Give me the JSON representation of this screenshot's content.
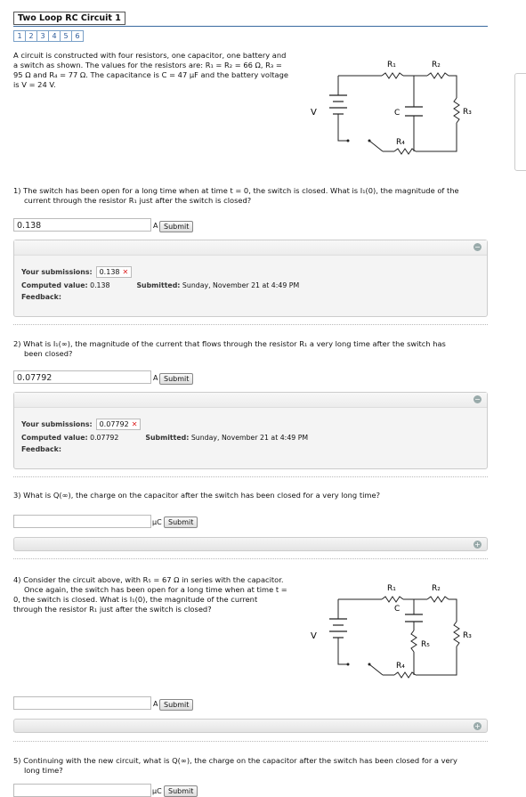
{
  "header": {
    "title": "Two Loop RC Circuit 1",
    "tabs": [
      "1",
      "2",
      "3",
      "4",
      "5",
      "6"
    ]
  },
  "intro": {
    "line1": "A circuit is constructed with four resistors, one capacitor, one battery and",
    "line2": "a switch as shown. The values for the resistors are: R₁ = R₂ = 66 Ω, R₃ =",
    "line3": "95 Ω and R₄ = 77 Ω. The capacitance is C = 47 μF and the battery voltage",
    "line4": "is V = 24 V."
  },
  "circuit": {
    "r1": "R₁",
    "r2": "R₂",
    "r3": "R₃",
    "r4": "R₄",
    "r5": "R₅",
    "c": "C",
    "v": "V"
  },
  "q1": {
    "line1": "1) The switch has been open for a long time when at time t = 0, the switch is closed. What is I₁(0), the magnitude of the",
    "line2": "current through the resistor R₁ just after the switch is closed?",
    "value": "0.138",
    "unit": "A",
    "submit": "Submit",
    "submissions_label": "Your submissions:",
    "submission": "0.138",
    "computed_label": "Computed value:",
    "computed": "0.138",
    "submitted_label": "Submitted:",
    "submitted": "Sunday, November 21 at 4:49 PM",
    "feedback_label": "Feedback:"
  },
  "q2": {
    "line1": "2) What is I₁(∞), the magnitude of the current that flows through the resistor R₁ a very long time after the switch has",
    "line2": "been closed?",
    "value": "0.07792",
    "unit": "A",
    "submit": "Submit",
    "submissions_label": "Your submissions:",
    "submission": "0.07792",
    "computed_label": "Computed value:",
    "computed": "0.07792",
    "submitted_label": "Submitted:",
    "submitted": "Sunday, November 21 at 4:49 PM",
    "feedback_label": "Feedback:"
  },
  "q3": {
    "line1": "3) What is Q(∞), the charge on the capacitor after the switch has been closed for a very long time?",
    "value": "",
    "unit": "μC",
    "submit": "Submit"
  },
  "q4": {
    "line1": "4) Consider the circuit above, with R₅ = 67 Ω in series with the capacitor.",
    "line2": "Once again, the switch has been open for a long time when at time t =",
    "line3": "0, the switch is closed. What is I₁(0), the magnitude of the current",
    "line4": "through the resistor R₁ just after the switch is closed?",
    "value": "",
    "unit": "A",
    "submit": "Submit"
  },
  "q5": {
    "line1": "5) Continuing with the new circuit, what is Q(∞), the charge on the capacitor after the switch has been closed for a very",
    "line2": "long time?",
    "unit": "μC",
    "submit": "Submit"
  },
  "icons": {
    "expand": "plus-circle-icon",
    "collapse": "minus-circle-icon",
    "wrong": "x-mark-icon"
  }
}
